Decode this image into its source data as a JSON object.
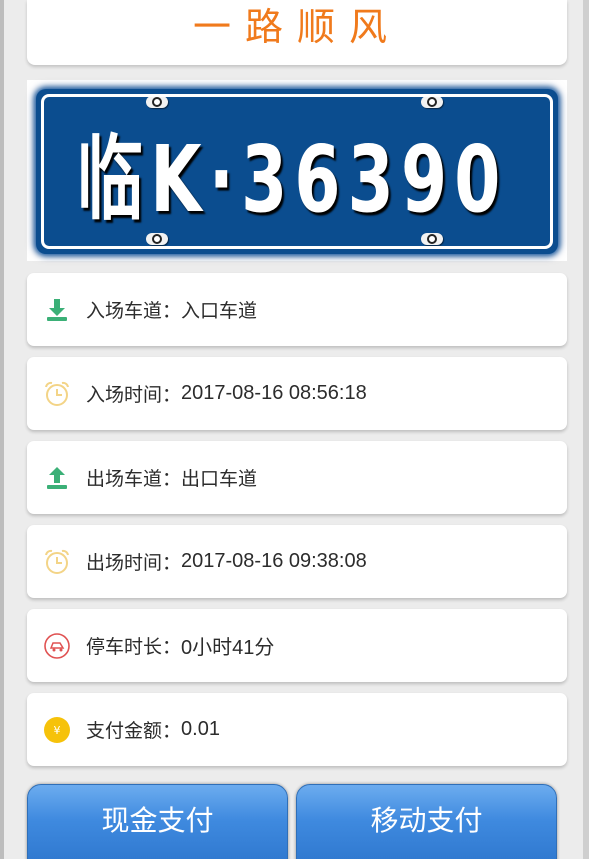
{
  "greeting": {
    "text": "一路顺风"
  },
  "plate": {
    "number": "临K·36390"
  },
  "info": [
    {
      "icon": "download-icon",
      "label": "入场车道：",
      "value": "入口车道"
    },
    {
      "icon": "alarm-clock-icon",
      "label": "入场时间：",
      "value": "2017-08-16 08:56:18"
    },
    {
      "icon": "upload-icon",
      "label": "出场车道：",
      "value": "出口车道"
    },
    {
      "icon": "alarm-clock-icon",
      "label": "出场时间：",
      "value": "2017-08-16 09:38:08"
    },
    {
      "icon": "car-time-icon",
      "label": "停车时长：",
      "value": "0小时41分"
    },
    {
      "icon": "yen-coin-icon",
      "label": "支付金额：",
      "value": "0.01"
    }
  ],
  "buttons": {
    "cash": "现金支付",
    "mobile": "移动支付"
  },
  "colors": {
    "greeting": "#f07a1c",
    "plate_bg": "#0b4d8f",
    "download_icon": "#3bb077",
    "alarm_icon": "#f3d487",
    "car_icon": "#e05252",
    "yen_icon": "#f6c20a",
    "button": "#3f8adf"
  }
}
